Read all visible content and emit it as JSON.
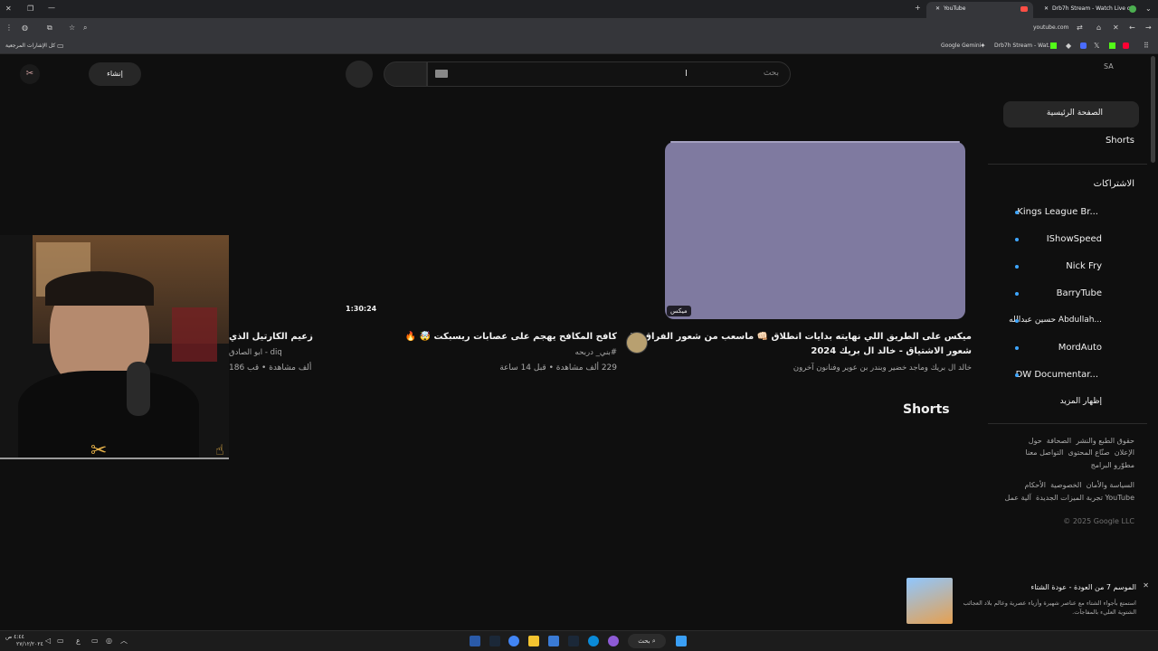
{
  "browser": {
    "tabs": [
      {
        "label": "YouTube",
        "active": true
      },
      {
        "label": "Drb7h Stream - Watch Live on"
      }
    ],
    "address": "youtube.com",
    "bookmarks": {
      "left": "كل الإشارات المرجعية",
      "items": [
        "Google Gemini",
        "Drb7h Stream - Wat..."
      ]
    }
  },
  "header": {
    "region": "SA",
    "search_placeholder": "بحث",
    "create_label": "إنشاء"
  },
  "sidebar": {
    "home": "الصفحة الرئيسية",
    "shorts": "Shorts",
    "subscriptions_title": "الاشتراكات",
    "subscriptions": [
      "Kings League Br...",
      "IShowSpeed",
      "Nick Fry",
      "BarryTube",
      "حسين عبدالله Abdullah...",
      "MordAuto",
      "DW Documentar..."
    ],
    "show_more": "إظهار المزيد",
    "footer1": [
      "حول",
      "الصحافة",
      "حقوق الطبع والنشر"
    ],
    "footer2": [
      "التواصل معنا",
      "صنّاع المحتوى",
      "الإعلان"
    ],
    "footer3": [
      "مطوّرو البرامج"
    ],
    "footer4": [
      "الأحكام",
      "الخصوصية",
      "السياسة والأمان"
    ],
    "footer5": [
      "آلية عمل YouTube",
      "تجربة الميزات الجديدة"
    ],
    "copyright": "© 2025 Google LLC"
  },
  "videos": [
    {
      "badge": "ميكس",
      "title_line1": "ميكس على الطريق اللي نهايته بدايات انطلاق 👊🏻 ماسعب من شعور الفراق الا",
      "title_line2": "شعور الاشتياق - خالد ال بريك 2024",
      "meta": "خالد ال بريك وماجد خضير وبندر بن عوير وفنانون آخرون",
      "thumb_color": "#7f7aa0"
    },
    {
      "duration": "1:30:24",
      "title_line1": "كافح المكافح يهجم على عصابات ريسبكت 🤯 🔥",
      "channel": "#بني_ دربحه",
      "meta": "229 ألف مشاهدة • قبل 14 ساعة"
    },
    {
      "title_line1": "زعيم الكارتيل الذي",
      "channel": "ابو الصادق - diq",
      "meta": "186 ألف مشاهدة • قب"
    }
  ],
  "shorts_title": "Shorts",
  "notification": {
    "title": "الموسم 7 من العودة - عودة الشتاء",
    "body_line1": "استمتع بأجواء الشتاء مع عناصر شهيرة وأزياء عصرية وعالم بلاد العجائب",
    "body_line2": "الشتوية العليء بالمفاجآت."
  },
  "taskbar": {
    "search": "بحث",
    "time": "٤:٤٤ ص",
    "date": "٢٧/١٢/٢٠٢٤"
  },
  "colors": {
    "background": "#0f0f0f",
    "accent": "#3ea6ff",
    "mix_thumb": "#7f7aa0"
  }
}
